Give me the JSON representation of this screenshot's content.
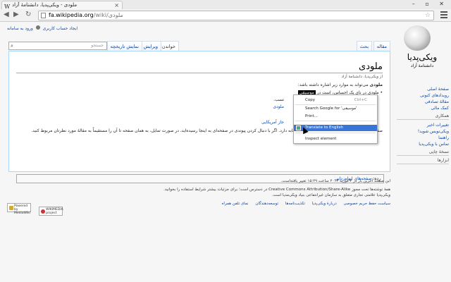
{
  "browser": {
    "tab_title": "ملودی - ویکی‌پدیا، دانشنامهٔ آزاد",
    "tab_favicon": "W",
    "url_host": "fa.wikipedia.org",
    "url_path": "/wiki/ملودی",
    "window_controls": "– ▫ ✕"
  },
  "personal": {
    "login": "ورود به سامانه",
    "create": "ایجاد حساب کاربری"
  },
  "logo": {
    "name": "ویکی‌پدیا",
    "tagline": "دانشنامهٔ آزاد"
  },
  "sidebar": {
    "main": [
      "صفحهٔ اصلی",
      "رویدادهای کنونی",
      "مقالهٔ تصادفی",
      "کمک مالی"
    ],
    "interaction_head": "همکاری",
    "interaction": [
      "تغییرات اخیر",
      "ویکی‌نویس شوید!",
      "راهنما",
      "تماس با ویکی‌پدیا"
    ],
    "print_head": "نسخهٔ چاپی",
    "tools_head": "ابزارها"
  },
  "tabs": {
    "article": "مقاله",
    "talk": "بحث",
    "read": "خواندن",
    "edit": "ویرایش",
    "history": "نمایش تاریخچه",
    "search_placeholder": "جستجو"
  },
  "content": {
    "title": "ملودی",
    "from": "از ویکی‌پدیا، دانشنامهٔ آزاد",
    "intro_bold": "ملودی",
    "intro_rest": " می‌تواند به موارد زیر اشاره داشته باشد:",
    "item1_a": "ملودی در نای یک احساس، است در ",
    "item1_b": "موسیقی",
    "item2": "ملودی",
    "item3": "نسب.",
    "item4": "جاز آمریکایی",
    "para": "صفحهٔ ابهام‌زدایی به صفحات گوناگون با نام‌های مشابه دارد. اگر با دنبال کردن پیوندی در صفحه‌ای به اینجا رسیده‌اید، در صورت تمایل، به همان صفحه",
    "para2": "تا آن را مستقیماً به مقالهٔ مورد نظرتان مربوط کنید.",
    "cats_label": "رده:",
    "cats_value": "صفحه‌های ابهام‌زدایی"
  },
  "footer": {
    "modified": "این صفحه آخرین بار در ۳ فوریهٔ ۲۰۱۳ ساعت ۱۵:۲۹ تغییر یافته‌است.",
    "license": "همهٔ نوشته‌ها تحت مجوز Creative Commons Attribution/Share-Alike در دسترس است؛ برای جزئیات بیشتر شرایط استفاده را بخوانید.",
    "license2": "ویکی‌پدیا علامتی تجاری متعلق به سازمان غیرانتفاعی بنیاد ویکی‌مدیا است.",
    "links": [
      "سیاست حفظ حریم خصوصی",
      "دربارهٔ ویکی‌پدیا",
      "تکذیب‌نامه‌ها",
      "توسعه‌دهندگان",
      "نمای تلفن همراه"
    ],
    "badge_wm": "WIKIMEDIA project",
    "badge_mw": "Powered by MediaWiki"
  },
  "context_menu": {
    "copy": "Copy",
    "copy_shortcut": "Ctrl+C",
    "search_google": "Search Google for 'موسیقی'",
    "print": "Print...",
    "translate": "Translate to English",
    "inspect": "Inspect element"
  }
}
